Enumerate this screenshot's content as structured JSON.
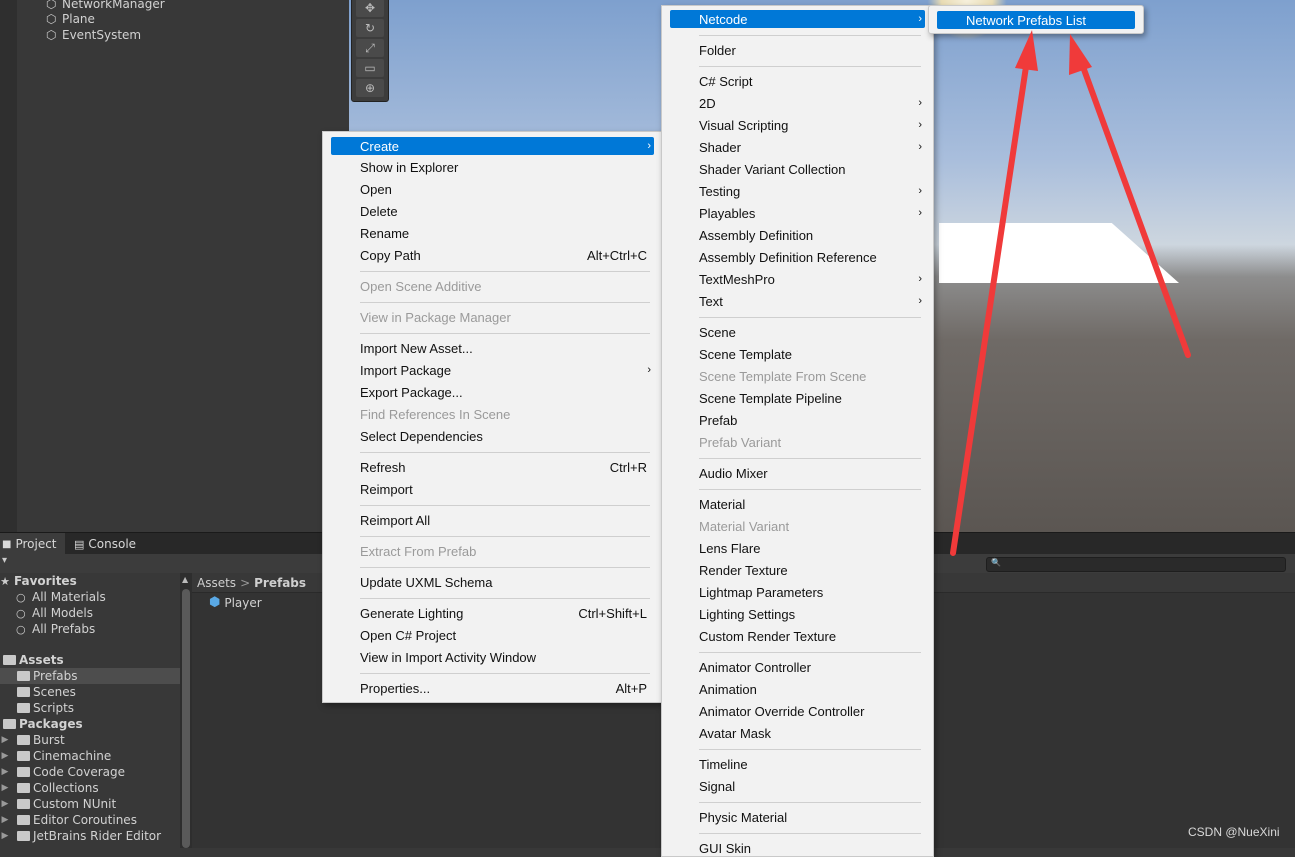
{
  "hierarchy": {
    "items": [
      "NetworkManager",
      "Plane",
      "EventSystem"
    ]
  },
  "bottom_tabs": [
    {
      "label": "Project",
      "icon": "folder-icon"
    },
    {
      "label": "Console",
      "icon": "console-icon"
    }
  ],
  "project_tree": {
    "favorites": {
      "label": "Favorites",
      "items": [
        "All Materials",
        "All Models",
        "All Prefabs"
      ]
    },
    "assets": {
      "label": "Assets",
      "items": [
        "Prefabs",
        "Scenes",
        "Scripts"
      ],
      "selected": "Prefabs"
    },
    "packages": {
      "label": "Packages",
      "items": [
        "Burst",
        "Cinemachine",
        "Code Coverage",
        "Collections",
        "Custom NUnit",
        "Editor Coroutines",
        "JetBrains Rider Editor"
      ]
    }
  },
  "breadcrumb": {
    "root": "Assets",
    "separator": ">",
    "current": "Prefabs"
  },
  "content_items": [
    "Player"
  ],
  "context_menu": {
    "create": "Create",
    "show_in_explorer": "Show in Explorer",
    "open": "Open",
    "delete": "Delete",
    "rename": "Rename",
    "copy_path": "Copy Path",
    "copy_path_shortcut": "Alt+Ctrl+C",
    "open_scene_additive": "Open Scene Additive",
    "view_in_package_manager": "View in Package Manager",
    "import_new_asset": "Import New Asset...",
    "import_package": "Import Package",
    "export_package": "Export Package...",
    "find_references": "Find References In Scene",
    "select_dependencies": "Select Dependencies",
    "refresh": "Refresh",
    "refresh_shortcut": "Ctrl+R",
    "reimport": "Reimport",
    "reimport_all": "Reimport All",
    "extract_from_prefab": "Extract From Prefab",
    "update_uxml": "Update UXML Schema",
    "generate_lighting": "Generate Lighting",
    "generate_lighting_shortcut": "Ctrl+Shift+L",
    "open_csharp_project": "Open C# Project",
    "view_import_activity": "View in Import Activity Window",
    "properties": "Properties...",
    "properties_shortcut": "Alt+P"
  },
  "create_menu": {
    "netcode": "Netcode",
    "folder": "Folder",
    "csharp_script": "C# Script",
    "two_d": "2D",
    "visual_scripting": "Visual Scripting",
    "shader": "Shader",
    "shader_variant_collection": "Shader Variant Collection",
    "testing": "Testing",
    "playables": "Playables",
    "assembly_definition": "Assembly Definition",
    "assembly_definition_reference": "Assembly Definition Reference",
    "textmeshpro": "TextMeshPro",
    "text": "Text",
    "scene": "Scene",
    "scene_template": "Scene Template",
    "scene_template_from_scene": "Scene Template From Scene",
    "scene_template_pipeline": "Scene Template Pipeline",
    "prefab": "Prefab",
    "prefab_variant": "Prefab Variant",
    "audio_mixer": "Audio Mixer",
    "material": "Material",
    "material_variant": "Material Variant",
    "lens_flare": "Lens Flare",
    "render_texture": "Render Texture",
    "lightmap_parameters": "Lightmap Parameters",
    "lighting_settings": "Lighting Settings",
    "custom_render_texture": "Custom Render Texture",
    "animator_controller": "Animator Controller",
    "animation": "Animation",
    "animator_override_controller": "Animator Override Controller",
    "avatar_mask": "Avatar Mask",
    "timeline": "Timeline",
    "signal": "Signal",
    "physic_material": "Physic Material",
    "gui_skin": "GUI Skin"
  },
  "netcode_menu": {
    "network_prefabs_list": "Network Prefabs List"
  },
  "watermark": "CSDN @NueXini",
  "colors": {
    "highlight": "#0078d7",
    "annotation_arrow": "#f03a3a"
  }
}
